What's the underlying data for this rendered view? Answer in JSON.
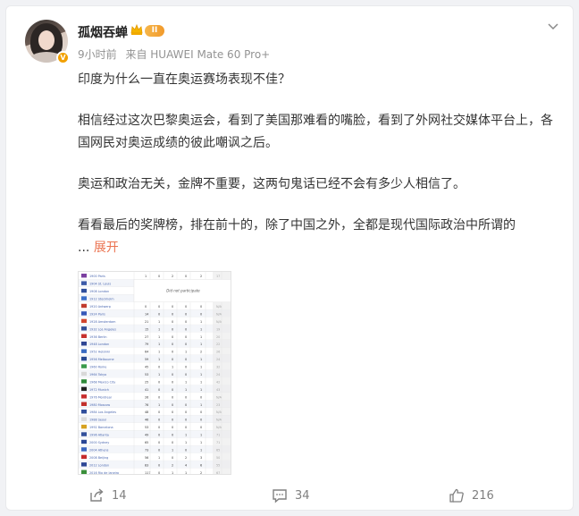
{
  "post": {
    "author": "孤烟吞蝉",
    "level": "II",
    "verified_mark": "V",
    "time": "9小时前",
    "source": "来自 HUAWEI Mate 60 Pro+",
    "paragraphs": [
      "印度为什么一直在奥运赛场表现不佳？",
      "相信经过这次巴黎奥运会，看到了美国那难看的嘴脸，看到了外网社交媒体平台上，各国网民对奥运成绩的彼此嘲讽之后。",
      "奥运和政治无关，金牌不重要，这两句鬼话已经不会有多少人相信了。"
    ],
    "last_paragraph": "看看最后的奖牌榜，排在前十的，除了中国之外，全都是现代国际政治中所谓的",
    "ellipsis": "...",
    "expand_label": "展开"
  },
  "image_table": {
    "header": [
      "1",
      "0",
      "2",
      "0",
      "2",
      "17"
    ],
    "note": "Did not participate",
    "rows": [
      {
        "flag": "#7b3fa0",
        "city": "1900 Paris",
        "vals": [
          "1",
          "0",
          "2",
          "0",
          "2",
          "17"
        ]
      },
      {
        "flag": "#3c5aa8",
        "city": "1904 St. Louis",
        "vals": []
      },
      {
        "flag": "#2f4f9c",
        "city": "1908 London",
        "vals": []
      },
      {
        "flag": "#3b6fc9",
        "city": "1912 Stockholm",
        "vals": []
      },
      {
        "flag": "#c13b2d",
        "city": "1920 Antwerp",
        "vals": [
          "0",
          "0",
          "0",
          "0",
          "0",
          "N/A"
        ]
      },
      {
        "flag": "#3658b8",
        "city": "1924 Paris",
        "vals": [
          "14",
          "0",
          "0",
          "0",
          "0",
          "N/A"
        ]
      },
      {
        "flag": "#d2472f",
        "city": "1928 Amsterdam",
        "vals": [
          "21",
          "1",
          "0",
          "0",
          "1",
          "N/A"
        ]
      },
      {
        "flag": "#334f97",
        "city": "1932 Los Angeles",
        "vals": [
          "15",
          "1",
          "0",
          "0",
          "1",
          "19"
        ]
      },
      {
        "flag": "#c7312d",
        "city": "1936 Berlin",
        "vals": [
          "27",
          "1",
          "0",
          "0",
          "1",
          "20"
        ]
      },
      {
        "flag": "#2e4593",
        "city": "1948 London",
        "vals": [
          "79",
          "1",
          "0",
          "0",
          "1",
          "22"
        ]
      },
      {
        "flag": "#3b6cc2",
        "city": "1952 Helsinki",
        "vals": [
          "64",
          "1",
          "0",
          "1",
          "2",
          "26"
        ]
      },
      {
        "flag": "#294a92",
        "city": "1956 Melbourne",
        "vals": [
          "59",
          "1",
          "0",
          "0",
          "1",
          "24"
        ]
      },
      {
        "flag": "#3a9a4a",
        "city": "1960 Rome",
        "vals": [
          "45",
          "0",
          "1",
          "0",
          "1",
          "32"
        ]
      },
      {
        "flag": "#d8d8d8",
        "city": "1964 Tokyo",
        "vals": [
          "53",
          "1",
          "0",
          "0",
          "1",
          "24"
        ]
      },
      {
        "flag": "#2f8a3a",
        "city": "1968 Mexico City",
        "vals": [
          "25",
          "0",
          "0",
          "1",
          "1",
          "42"
        ]
      },
      {
        "flag": "#222222",
        "city": "1972 Munich",
        "vals": [
          "41",
          "0",
          "0",
          "1",
          "1",
          "43"
        ]
      },
      {
        "flag": "#c72c2c",
        "city": "1976 Montreal",
        "vals": [
          "26",
          "0",
          "0",
          "0",
          "0",
          "N/A"
        ]
      },
      {
        "flag": "#c2302c",
        "city": "1980 Moscow",
        "vals": [
          "76",
          "1",
          "0",
          "0",
          "1",
          "23"
        ]
      },
      {
        "flag": "#314f9c",
        "city": "1984 Los Angeles",
        "vals": [
          "48",
          "0",
          "0",
          "0",
          "0",
          "N/A"
        ]
      },
      {
        "flag": "#dadada",
        "city": "1988 Seoul",
        "vals": [
          "46",
          "0",
          "0",
          "0",
          "0",
          "N/A"
        ]
      },
      {
        "flag": "#d7a221",
        "city": "1992 Barcelona",
        "vals": [
          "53",
          "0",
          "0",
          "0",
          "0",
          "N/A"
        ]
      },
      {
        "flag": "#33509b",
        "city": "1996 Atlanta",
        "vals": [
          "49",
          "0",
          "0",
          "1",
          "1",
          "71"
        ]
      },
      {
        "flag": "#2a4796",
        "city": "2000 Sydney",
        "vals": [
          "65",
          "0",
          "0",
          "1",
          "1",
          "71"
        ]
      },
      {
        "flag": "#3a66c0",
        "city": "2004 Athens",
        "vals": [
          "73",
          "0",
          "1",
          "0",
          "1",
          "65"
        ]
      },
      {
        "flag": "#c62b2b",
        "city": "2008 Beijing",
        "vals": [
          "56",
          "1",
          "0",
          "2",
          "3",
          "50"
        ]
      },
      {
        "flag": "#2d4796",
        "city": "2012 London",
        "vals": [
          "83",
          "0",
          "2",
          "4",
          "6",
          "55"
        ]
      },
      {
        "flag": "#3a8f3a",
        "city": "2016 Rio de Janeiro",
        "vals": [
          "117",
          "0",
          "1",
          "1",
          "2",
          "67"
        ]
      }
    ]
  },
  "actions": {
    "share_count": "14",
    "comment_count": "34",
    "like_count": "216"
  },
  "colors": {
    "accent": "#eb7350",
    "meta_gray": "#939393",
    "text": "#333333"
  }
}
